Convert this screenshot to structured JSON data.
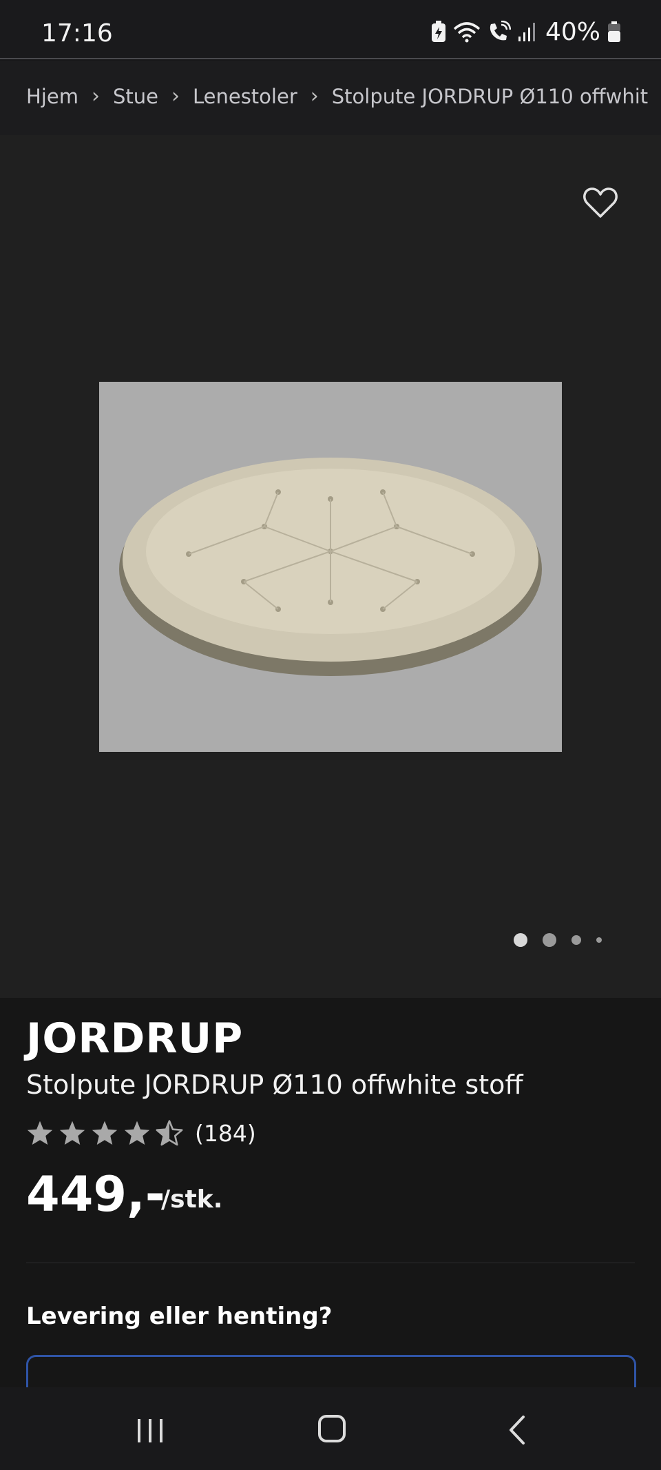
{
  "status_bar": {
    "time": "17:16",
    "battery_pct": "40%",
    "icons": [
      "battery-saver-icon",
      "wifi-icon",
      "wifi-calling-icon",
      "signal-icon",
      "battery-icon"
    ]
  },
  "breadcrumb": {
    "items": [
      "Hjem",
      "Stue",
      "Lenestoler",
      "Stolpute JORDRUP Ø110 offwhit"
    ]
  },
  "gallery": {
    "image_alt": "Stolpute JORDRUP",
    "favorite_icon": "heart-outline-icon",
    "active_index": 0,
    "dot_count": 4
  },
  "product": {
    "brand": "JORDRUP",
    "name": "Stolpute JORDRUP Ø110 offwhite stoff",
    "rating": 4.5,
    "review_count": "(184)",
    "price": "449,-",
    "unit": "/stk."
  },
  "delivery": {
    "heading": "Levering eller henting?"
  },
  "colors": {
    "background": "#171719",
    "gallery_bg": "#202020",
    "accent_border": "#2f54a6",
    "star": "#a9a9a9"
  },
  "nav_bar": {
    "icons": [
      "recents-icon",
      "home-icon",
      "back-icon"
    ]
  }
}
